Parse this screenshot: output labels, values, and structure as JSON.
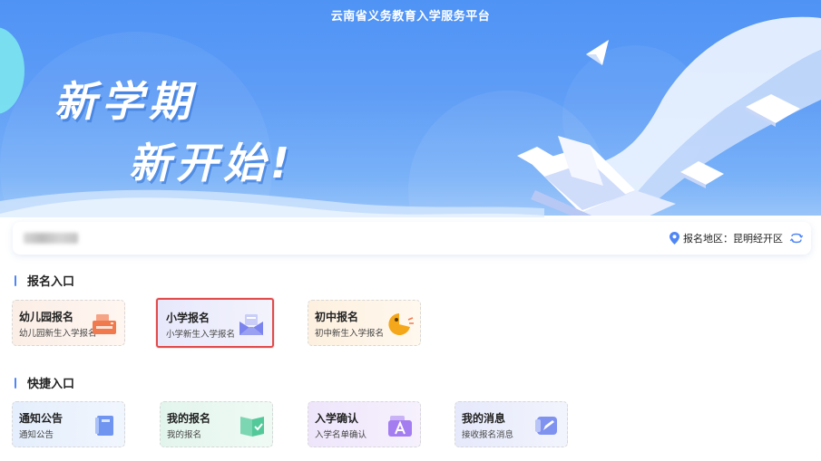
{
  "header": {
    "title": "云南省义务教育入学服务平台"
  },
  "banner": {
    "slogan_line1": "新学期",
    "slogan_line2": "新开始!"
  },
  "info_bar": {
    "region_label": "报名地区：",
    "region_value": "昆明经开区"
  },
  "registration": {
    "title": "报名入口",
    "items": [
      {
        "title": "幼儿园报名",
        "subtitle": "幼儿园新生入学报名",
        "icon": "printer-icon",
        "color": "#f07a4e"
      },
      {
        "title": "小学报名",
        "subtitle": "小学新生入学报名",
        "icon": "envelope-icon",
        "color": "#7b83ee",
        "selected": true
      },
      {
        "title": "初中报名",
        "subtitle": "初中新生入学报名",
        "icon": "pacman-icon",
        "color": "#f4a71b"
      }
    ]
  },
  "shortcuts": {
    "title": "快捷入口",
    "items": [
      {
        "title": "通知公告",
        "subtitle": "通知公告",
        "icon": "notice-book-icon",
        "color": "#6f95f0"
      },
      {
        "title": "我的报名",
        "subtitle": "我的报名",
        "icon": "check-book-icon",
        "color": "#53c99a"
      },
      {
        "title": "入学确认",
        "subtitle": "入学名单确认",
        "icon": "letter-a-icon",
        "color": "#a47ef0"
      },
      {
        "title": "我的消息",
        "subtitle": "接收报名消息",
        "icon": "message-edit-icon",
        "color": "#7f92f0"
      }
    ]
  }
}
